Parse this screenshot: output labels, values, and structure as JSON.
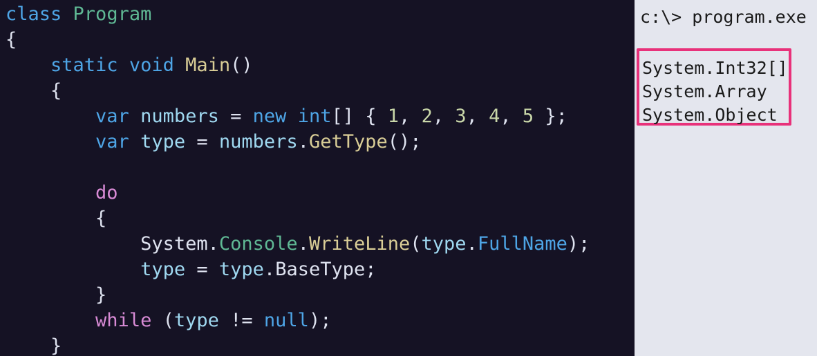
{
  "code": {
    "lines": [
      [
        [
          "class",
          "kw"
        ],
        [
          " ",
          "pl"
        ],
        [
          "Program",
          "ty"
        ]
      ],
      [
        [
          "{",
          "pl"
        ]
      ],
      [
        [
          "    ",
          "pl"
        ],
        [
          "static",
          "kw"
        ],
        [
          " ",
          "pl"
        ],
        [
          "void",
          "kw"
        ],
        [
          " ",
          "pl"
        ],
        [
          "Main",
          "fn"
        ],
        [
          "()",
          "pl"
        ]
      ],
      [
        [
          "    ",
          "pl"
        ],
        [
          "{",
          "pl"
        ]
      ],
      [
        [
          "        ",
          "pl"
        ],
        [
          "var",
          "kw"
        ],
        [
          " ",
          "pl"
        ],
        [
          "numbers",
          "var"
        ],
        [
          " = ",
          "pl"
        ],
        [
          "new",
          "kw"
        ],
        [
          " ",
          "pl"
        ],
        [
          "int",
          "kw"
        ],
        [
          "[] { ",
          "pl"
        ],
        [
          "1",
          "num"
        ],
        [
          ", ",
          "pl"
        ],
        [
          "2",
          "num"
        ],
        [
          ", ",
          "pl"
        ],
        [
          "3",
          "num"
        ],
        [
          ", ",
          "pl"
        ],
        [
          "4",
          "num"
        ],
        [
          ", ",
          "pl"
        ],
        [
          "5",
          "num"
        ],
        [
          " };",
          "pl"
        ]
      ],
      [
        [
          "        ",
          "pl"
        ],
        [
          "var",
          "kw"
        ],
        [
          " ",
          "pl"
        ],
        [
          "type",
          "var"
        ],
        [
          " = ",
          "pl"
        ],
        [
          "numbers",
          "var"
        ],
        [
          ".",
          "pl"
        ],
        [
          "GetType",
          "fn"
        ],
        [
          "();",
          "pl"
        ]
      ],
      [],
      [
        [
          "        ",
          "pl"
        ],
        [
          "do",
          "ctl"
        ]
      ],
      [
        [
          "        ",
          "pl"
        ],
        [
          "{",
          "pl"
        ]
      ],
      [
        [
          "            ",
          "pl"
        ],
        [
          "System",
          "pl"
        ],
        [
          ".",
          "pl"
        ],
        [
          "Console",
          "ty"
        ],
        [
          ".",
          "pl"
        ],
        [
          "WriteLine",
          "fn"
        ],
        [
          "(",
          "pl"
        ],
        [
          "type",
          "var"
        ],
        [
          ".",
          "pl"
        ],
        [
          "FullName",
          "kw"
        ],
        [
          ");",
          "pl"
        ]
      ],
      [
        [
          "            ",
          "pl"
        ],
        [
          "type",
          "var"
        ],
        [
          " = ",
          "pl"
        ],
        [
          "type",
          "var"
        ],
        [
          ".",
          "pl"
        ],
        [
          "BaseType",
          "pl"
        ],
        [
          ";",
          "pl"
        ]
      ],
      [
        [
          "        ",
          "pl"
        ],
        [
          "}",
          "pl"
        ]
      ],
      [
        [
          "        ",
          "pl"
        ],
        [
          "while",
          "ctl"
        ],
        [
          " (",
          "pl"
        ],
        [
          "type",
          "var"
        ],
        [
          " != ",
          "pl"
        ],
        [
          "null",
          "kw"
        ],
        [
          ");",
          "pl"
        ]
      ],
      [
        [
          "    ",
          "pl"
        ],
        [
          "}",
          "pl"
        ]
      ]
    ]
  },
  "console": {
    "prompt": "c:\\> program.exe",
    "output": [
      "System.Int32[]",
      "System.Array",
      "System.Object"
    ]
  },
  "colors": {
    "editor_bg": "#151224",
    "console_bg": "#e4e6ee",
    "highlight_border": "#e8317a"
  }
}
